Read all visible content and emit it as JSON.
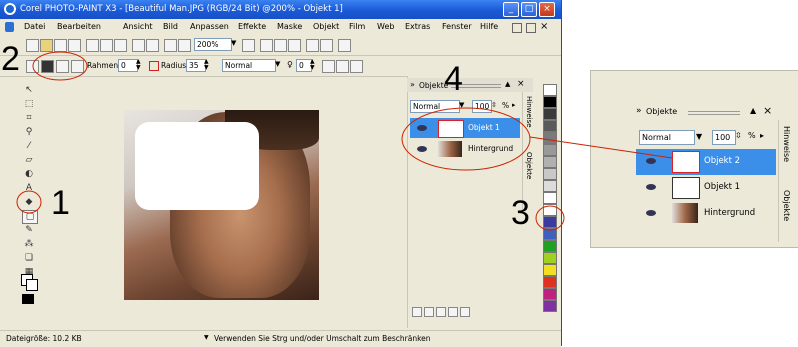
{
  "window": {
    "title": "Corel PHOTO-PAINT X3 - [Beautiful Man.JPG (RGB/24 Bit) @200% - Objekt 1]",
    "controls": [
      "_",
      "□",
      "×"
    ]
  },
  "menu": {
    "items": [
      "Datei",
      "Bearbeiten",
      "Ansicht",
      "Bild",
      "Anpassen",
      "Effekte",
      "Maske",
      "Objekt",
      "Film",
      "Web",
      "Extras",
      "Fenster",
      "Hilfe"
    ]
  },
  "toolbar1": {
    "zoom_value": "200%"
  },
  "toolbar2": {
    "rahmen_label": "Rahmen",
    "rahmen_value": "0",
    "radius_label": "Radius",
    "radius_value": "35",
    "mode_value": "Normal",
    "transparency_value": "0"
  },
  "statusbar": {
    "file_size": "Dateigröße: 10.2 KB",
    "hint": "Verwenden Sie Strg und/oder Umschalt zum Beschränken"
  },
  "docker_main": {
    "title": "Objekte",
    "mode": "Normal",
    "opacity": "100",
    "opacity_unit": "%",
    "layers": [
      {
        "name": "Objekt 1",
        "selected": true
      },
      {
        "name": "Hintergrund",
        "selected": false
      }
    ],
    "side_tabs": [
      "Hinweise",
      "Objekte"
    ]
  },
  "docker_zoom": {
    "title": "Objekte",
    "mode": "Normal",
    "opacity": "100",
    "opacity_unit": "%",
    "layers": [
      {
        "name": "Objekt 2",
        "selected": true
      },
      {
        "name": "Objekt 1",
        "selected": false
      },
      {
        "name": "Hintergrund",
        "selected": false
      }
    ],
    "side_tabs": [
      "Hinweise",
      "Objekte"
    ]
  },
  "annotations": {
    "n1": "1",
    "n2": "2",
    "n3": "3",
    "n4": "4"
  },
  "colors": {
    "accent_selection": "#3c8fe8",
    "annotation_line": "#cc2200",
    "titlebar": "#1b5ad6"
  },
  "palette_swatches": [
    "#ffffff",
    "#000000",
    "#3a3a3a",
    "#5a5a5a",
    "#7a7a7a",
    "#999999",
    "#b0b0b0",
    "#c8c8c8",
    "#dcdcdc",
    "#ffffff",
    "#ffffff",
    "#3a3aa0",
    "#4060c0",
    "#20a020",
    "#a0d020",
    "#f0e020",
    "#e03020",
    "#c02080",
    "#8030a0"
  ]
}
